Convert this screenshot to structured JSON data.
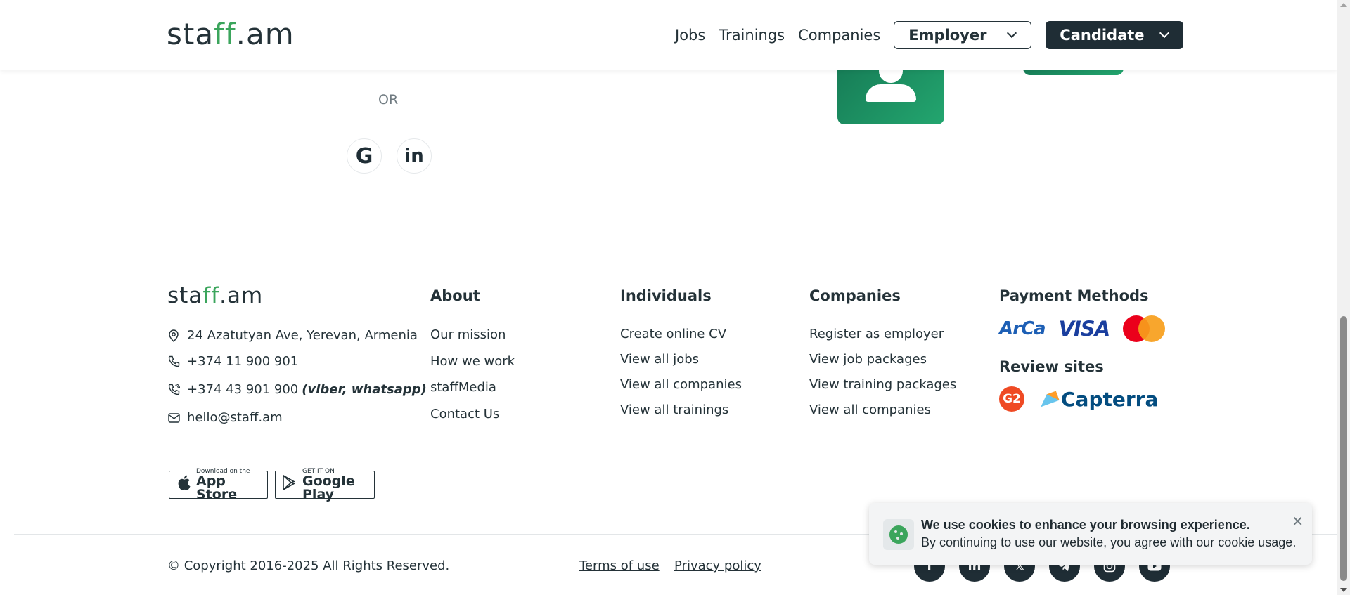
{
  "header": {
    "logo_text_start": "sta",
    "logo_text_mid": "ff",
    "logo_text_end": ".am",
    "nav": [
      "Jobs",
      "Trainings",
      "Companies"
    ],
    "employer_label": "Employer",
    "candidate_label": "Candidate"
  },
  "login": {
    "or_text": "OR",
    "google_glyph": "G",
    "linkedin_glyph": "in"
  },
  "footer": {
    "logo_text_start": "sta",
    "logo_text_mid": "ff",
    "logo_text_end": ".am",
    "address": "24 Azatutyan Ave, Yerevan, Armenia",
    "phone1": "+374 11 900 901",
    "phone2": "+374 43 901 900",
    "phone2_note": "(viber, whatsapp)",
    "email": "hello@staff.am",
    "about": {
      "title": "About",
      "links": [
        "Our mission",
        "How we work",
        "staffMedia",
        "Contact Us"
      ]
    },
    "individuals": {
      "title": "Individuals",
      "links": [
        "Create online CV",
        "View all jobs",
        "View all companies",
        "View all trainings"
      ]
    },
    "companies": {
      "title": "Companies",
      "links": [
        "Register as employer",
        "View job packages",
        "View training packages",
        "View all companies"
      ]
    },
    "payment": {
      "title": "Payment Methods",
      "arca": "ArCa",
      "visa": "VISA"
    },
    "review": {
      "title": "Review sites",
      "g2": "G2",
      "capterra": "Capterra"
    },
    "app_store": {
      "small": "Download on the",
      "big": "App Store"
    },
    "google_play": {
      "small": "GET IT ON",
      "big": "Google Play"
    },
    "copyright": "© Copyright 2016-2025 All Rights Reserved.",
    "terms": "Terms of use",
    "privacy": "Privacy policy"
  },
  "cookie": {
    "title": "We use cookies to enhance your browsing experience.",
    "text": "By continuing to use our website, you agree with our cookie usage.",
    "close": "✕"
  },
  "colors": {
    "brand_dark": "#1f2d35",
    "brand_green": "#3ba55c"
  }
}
